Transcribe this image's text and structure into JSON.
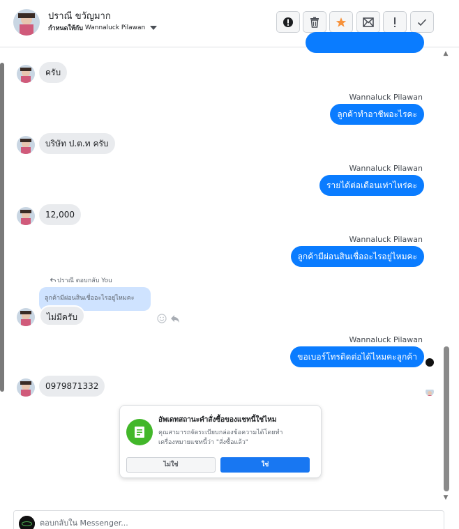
{
  "contact": {
    "name": "ปราณี ขวัญมาก",
    "assigned_label": "กำหนดให้กับ",
    "assigned_to": "Wannaluck Pilawan"
  },
  "toolbar": [
    {
      "name": "spam-button",
      "icon": "alert-circle-icon"
    },
    {
      "name": "delete-button",
      "icon": "trash-icon"
    },
    {
      "name": "star-button",
      "icon": "star-icon",
      "color": "#f7923b"
    },
    {
      "name": "mark-unread-button",
      "icon": "envelope-icon"
    },
    {
      "name": "follow-up-button",
      "icon": "exclamation-icon"
    },
    {
      "name": "done-button",
      "icon": "check-icon"
    }
  ],
  "messages": {
    "in_1": "ครับ",
    "out_1_sender": "Wannaluck Pilawan",
    "out_1": "ลูกค้าทำอาชีพอะไรคะ",
    "in_2": "บริษัท ป.ต.ท ครับ",
    "out_2_sender": "Wannaluck Pilawan",
    "out_2": "รายได้ต่อเดือนเท่าไหร่คะ",
    "in_3": "12,000",
    "out_3_sender": "Wannaluck Pilawan",
    "out_3": "ลูกค้ามีผ่อนสินเชื่ออะไรอยู่ไหมคะ",
    "reply_meta": "ปราณี ตอบกลับ You",
    "quoted": "ลูกค้ามีผ่อนสินเชื่ออะไรอยู่ไหมคะ",
    "in_4": "ไม่มีครับ",
    "out_4_sender": "Wannaluck Pilawan",
    "out_4": "ขอเบอร์โทรติดต่อได้ไหมคะลูกค้า",
    "in_5": "0979871332"
  },
  "popup": {
    "title": "อัพเดทสถานะคำสั่งซื้อของแชทนี้ใช่ไหม",
    "body": "คุณสามารถจัดระเบียบกล่องข้อความได้โดยทำเครื่องหมายแชทนี้ว่า \"สั่งซื้อแล้ว\"",
    "no_label": "ไม่ใช่",
    "yes_label": "ใช่"
  },
  "composer": {
    "placeholder": "ตอบกลับใน Messenger..."
  },
  "colors": {
    "outgoing_bubble": "#0a7cff",
    "incoming_bubble": "#e9ebee",
    "primary_button": "#1877f2",
    "popup_icon": "#42b72a"
  }
}
